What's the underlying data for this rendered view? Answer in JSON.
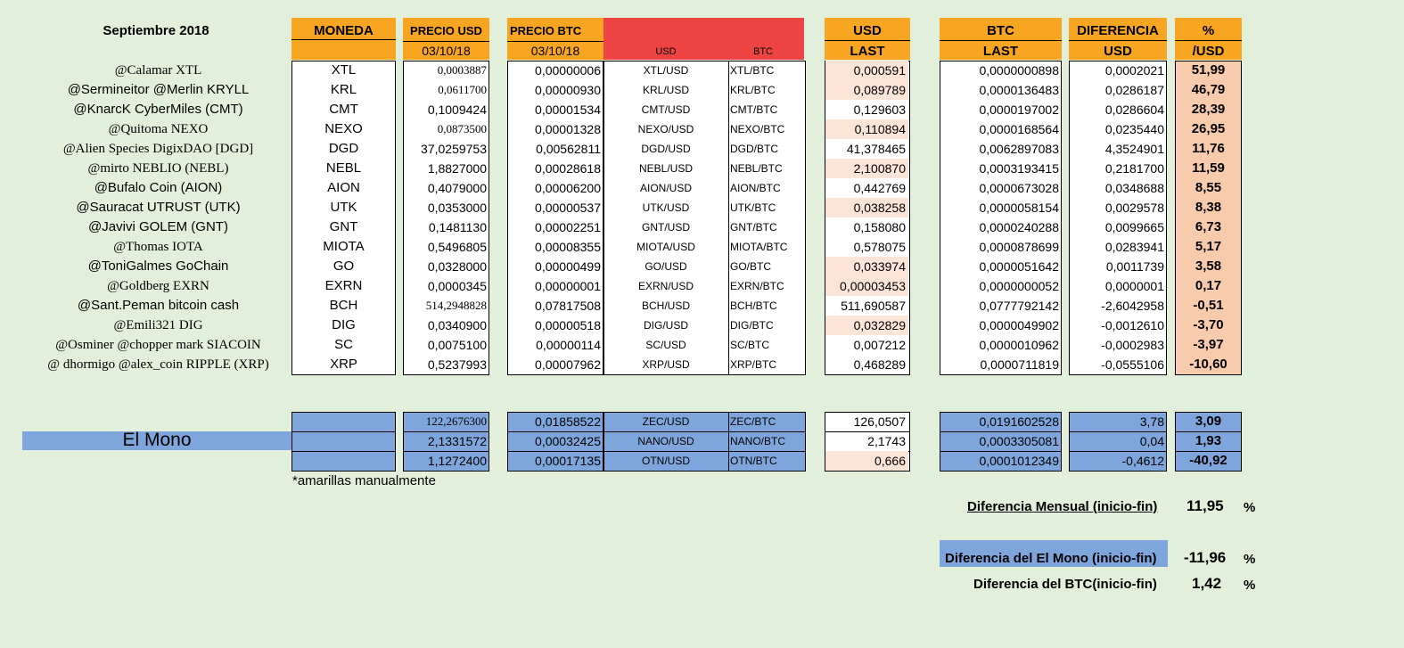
{
  "title": "Septiembre 2018",
  "headers": {
    "moneda": "MONEDA",
    "precio_usd": "PRECIO USD",
    "precio_btc": "PRECIO BTC",
    "date1": "03/10/18",
    "date2": "03/10/18",
    "usd_small": "USD",
    "btc_small": "BTC",
    "usd_last_1": "USD",
    "usd_last_2": "LAST",
    "btc_last_1": "BTC",
    "btc_last_2": "LAST",
    "dif_1": "DIFERENCIA",
    "dif_2": "USD",
    "pct_1": "%",
    "pct_2": "/USD"
  },
  "rows": [
    {
      "label": "@Calamar XTL",
      "serif": true,
      "coin": "XTL",
      "precio_usd": "0,0003887",
      "precio_btc": "0,00000006",
      "pair_usd": "XTL/USD",
      "pair_btc": "XTL/BTC",
      "usd_last": "0,000591",
      "usd_peach": true,
      "btc_last": "0,0000000898",
      "dif": "0,0002021",
      "pct": "51,99",
      "usd_small": true
    },
    {
      "label": "@Sermineitor  @Merlin KRYLL",
      "serif": false,
      "coin": "KRL",
      "precio_usd": "0,0611700",
      "precio_btc": "0,00000930",
      "pair_usd": "KRL/USD",
      "pair_btc": "KRL/BTC",
      "usd_last": "0,089789",
      "usd_peach": true,
      "btc_last": "0,0000136483",
      "dif": "0,0286187",
      "pct": "46,79",
      "usd_small": true
    },
    {
      "label": "@KnarcK CyberMiles (CMT)",
      "serif": false,
      "coin": "CMT",
      "precio_usd": "0,1009424",
      "precio_btc": "0,00001534",
      "pair_usd": "CMT/USD",
      "pair_btc": "CMT/BTC",
      "usd_last": "0,129603",
      "usd_peach": false,
      "btc_last": "0,0000197002",
      "dif": "0,0286604",
      "pct": "28,39",
      "usd_small": false
    },
    {
      "label": "@Quitoma NEXO",
      "serif": true,
      "coin": "NEXO",
      "precio_usd": "0,0873500",
      "precio_btc": "0,00001328",
      "pair_usd": "NEXO/USD",
      "pair_btc": "NEXO/BTC",
      "usd_last": "0,110894",
      "usd_peach": true,
      "btc_last": "0,0000168564",
      "dif": "0,0235440",
      "pct": "26,95",
      "usd_small": true
    },
    {
      "label": "@Alien Species DigixDAO [DGD]",
      "serif": true,
      "coin": "DGD",
      "precio_usd": "37,0259753",
      "precio_btc": "0,00562811",
      "pair_usd": "DGD/USD",
      "pair_btc": "DGD/BTC",
      "usd_last": "41,378465",
      "usd_peach": false,
      "btc_last": "0,0062897083",
      "dif": "4,3524901",
      "pct": "11,76",
      "usd_small": false
    },
    {
      "label": "@mirto NEBLIO (NEBL)",
      "serif": true,
      "coin": "NEBL",
      "precio_usd": "1,8827000",
      "precio_btc": "0,00028618",
      "pair_usd": "NEBL/USD",
      "pair_btc": "NEBL/BTC",
      "usd_last": "2,100870",
      "usd_peach": true,
      "btc_last": "0,0003193415",
      "dif": "0,2181700",
      "pct": "11,59",
      "usd_small": false
    },
    {
      "label": "@Bufalo Coin (AION)",
      "serif": false,
      "coin": "AION",
      "precio_usd": "0,4079000",
      "precio_btc": "0,00006200",
      "pair_usd": "AION/USD",
      "pair_btc": "AION/BTC",
      "usd_last": "0,442769",
      "usd_peach": false,
      "btc_last": "0,0000673028",
      "dif": "0,0348688",
      "pct": "8,55",
      "usd_small": false
    },
    {
      "label": "@Sauracat UTRUST (UTK)",
      "serif": false,
      "coin": "UTK",
      "precio_usd": "0,0353000",
      "precio_btc": "0,00000537",
      "pair_usd": "UTK/USD",
      "pair_btc": "UTK/BTC",
      "usd_last": "0,038258",
      "usd_peach": true,
      "btc_last": "0,0000058154",
      "dif": "0,0029578",
      "pct": "8,38",
      "usd_small": false
    },
    {
      "label": "@Javivi GOLEM (GNT)",
      "serif": false,
      "coin": "GNT",
      "precio_usd": "0,1481130",
      "precio_btc": "0,00002251",
      "pair_usd": "GNT/USD",
      "pair_btc": "GNT/BTC",
      "usd_last": "0,158080",
      "usd_peach": false,
      "btc_last": "0,0000240288",
      "dif": "0,0099665",
      "pct": "6,73",
      "usd_small": false
    },
    {
      "label": "@Thomas IOTA",
      "serif": true,
      "coin": "MIOTA",
      "precio_usd": "0,5496805",
      "precio_btc": "0,00008355",
      "pair_usd": "MIOTA/USD",
      "pair_btc": "MIOTA/BTC",
      "usd_last": "0,578075",
      "usd_peach": false,
      "btc_last": "0,0000878699",
      "dif": "0,0283941",
      "pct": "5,17",
      "usd_small": false
    },
    {
      "label": "@ToniGalmes GoChain",
      "serif": false,
      "coin": "GO",
      "precio_usd": "0,0328000",
      "precio_btc": "0,00000499",
      "pair_usd": "GO/USD",
      "pair_btc": "GO/BTC",
      "usd_last": "0,033974",
      "usd_peach": true,
      "btc_last": "0,0000051642",
      "dif": "0,0011739",
      "pct": "3,58",
      "usd_small": false
    },
    {
      "label": "@Goldberg EXRN",
      "serif": true,
      "coin": "EXRN",
      "precio_usd": "0,0000345",
      "precio_btc": "0,00000001",
      "pair_usd": "EXRN/USD",
      "pair_btc": "EXRN/BTC",
      "usd_last": "0,00003453",
      "usd_peach": true,
      "btc_last": "0,0000000052",
      "dif": "0,0000001",
      "pct": "0,17",
      "usd_small": false
    },
    {
      "label": "@Sant.Peman bitcoin cash",
      "serif": false,
      "coin": "BCH",
      "precio_usd": "514,2948828",
      "precio_btc": "0,07817508",
      "pair_usd": "BCH/USD",
      "pair_btc": "BCH/BTC",
      "usd_last": "511,690587",
      "usd_peach": false,
      "btc_last": "0,0777792142",
      "dif": "-2,6042958",
      "pct": "-0,51",
      "usd_small": true
    },
    {
      "label": "@Emili321 DIG",
      "serif": true,
      "coin": "DIG",
      "precio_usd": "0,0340900",
      "precio_btc": "0,00000518",
      "pair_usd": "DIG/USD",
      "pair_btc": "DIG/BTC",
      "usd_last": "0,032829",
      "usd_peach": true,
      "btc_last": "0,0000049902",
      "dif": "-0,0012610",
      "pct": "-3,70",
      "usd_small": false
    },
    {
      "label": "@Osminer @chopper mark  SIACOIN",
      "serif": true,
      "coin": "SC",
      "precio_usd": "0,0075100",
      "precio_btc": "0,00000114",
      "pair_usd": "SC/USD",
      "pair_btc": "SC/BTC",
      "usd_last": "0,007212",
      "usd_peach": false,
      "btc_last": "0,0000010962",
      "dif": "-0,0002983",
      "pct": "-3,97",
      "usd_small": false
    },
    {
      "label": "@ dhormigo @alex_coin RIPPLE (XRP)",
      "serif": true,
      "coin": "XRP",
      "precio_usd": "0,5237993",
      "precio_btc": "0,00007962",
      "pair_usd": "XRP/USD",
      "pair_btc": "XRP/BTC",
      "usd_last": "0,468289",
      "usd_peach": false,
      "btc_last": "0,0000711819",
      "dif": "-0,0555106",
      "pct": "-10,60",
      "usd_small": false
    }
  ],
  "mono": {
    "label": "El Mono",
    "rows": [
      {
        "precio_usd": "122,2676300",
        "precio_btc": "0,01858522",
        "pair_usd": "ZEC/USD",
        "pair_btc": "ZEC/BTC",
        "usd_last": "126,0507",
        "usd_peach": false,
        "btc_last": "0,0191602528",
        "dif": "3,78",
        "pct": "3,09",
        "usd_small": true
      },
      {
        "precio_usd": "2,1331572",
        "precio_btc": "0,00032425",
        "pair_usd": "NANO/USD",
        "pair_btc": "NANO/BTC",
        "usd_last": "2,1743",
        "usd_peach": false,
        "btc_last": "0,0003305081",
        "dif": "0,04",
        "pct": "1,93",
        "usd_small": false
      },
      {
        "precio_usd": "1,1272400",
        "precio_btc": "0,00017135",
        "pair_usd": "OTN/USD",
        "pair_btc": "OTN/BTC",
        "usd_last": "0,666",
        "usd_peach": true,
        "btc_last": "0,0001012349",
        "dif": "-0,4612",
        "pct": "-40,92",
        "usd_small": false
      }
    ]
  },
  "note": "*amarillas manualmente",
  "summary": {
    "mensual_label": "Diferencia Mensual (inicio-fin)",
    "mensual_value": "11,95",
    "mono_label": "Diferencia del El Mono (inicio-fin)",
    "mono_value": "-11,96",
    "btc_label": "Diferencia del BTC(inicio-fin)",
    "btc_value": "1,42",
    "pct_sign": "%"
  },
  "colors": {
    "background": "#e2efda",
    "orange": "#f8a521",
    "red": "#ef4444",
    "peach": "#fce4d6",
    "pink": "#f8cbad",
    "blue": "#7ea6dc"
  }
}
